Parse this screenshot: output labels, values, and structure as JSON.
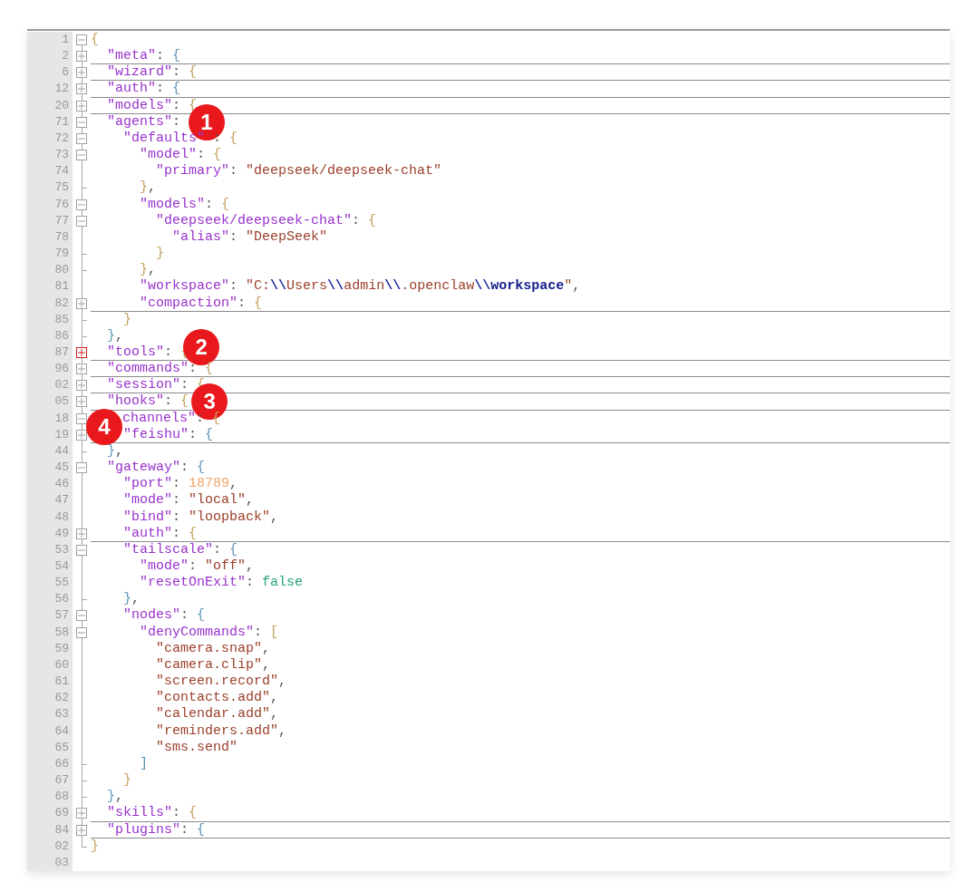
{
  "editor": {
    "lines": [
      {
        "number": "1",
        "kind": "start",
        "current": false,
        "tokens": [
          {
            "kind": "brace2",
            "text": "{"
          }
        ]
      },
      {
        "number": "2",
        "kind": "plus",
        "current": false,
        "tokens": [
          {
            "kind": "key",
            "text": "  \"meta\""
          },
          {
            "kind": "punct",
            "text": ": "
          },
          {
            "kind": "brace1",
            "text": "{"
          }
        ]
      },
      {
        "number": "6",
        "kind": "plus",
        "current": false,
        "tokens": [
          {
            "kind": "key",
            "text": "  \"wizard\""
          },
          {
            "kind": "punct",
            "text": ": "
          },
          {
            "kind": "brace2",
            "text": "{"
          }
        ]
      },
      {
        "number": "12",
        "kind": "plus",
        "current": false,
        "tokens": [
          {
            "kind": "key",
            "text": "  \"auth\""
          },
          {
            "kind": "punct",
            "text": ": "
          },
          {
            "kind": "brace1",
            "text": "{"
          }
        ]
      },
      {
        "number": "20",
        "kind": "plus",
        "current": false,
        "tokens": [
          {
            "kind": "key",
            "text": "  \"models\""
          },
          {
            "kind": "punct",
            "text": ": "
          },
          {
            "kind": "brace2",
            "text": "{"
          }
        ]
      },
      {
        "number": "71",
        "kind": "minus",
        "current": false,
        "tokens": [
          {
            "kind": "key",
            "text": "  \"agents\""
          },
          {
            "kind": "punct",
            "text": ":"
          },
          {
            "kind": "badge",
            "text": "1"
          }
        ]
      },
      {
        "number": "72",
        "kind": "minus",
        "current": false,
        "tokens": [
          {
            "kind": "key",
            "text": "    \"defaults\""
          },
          {
            "kind": "punct",
            "text": " : "
          },
          {
            "kind": "brace2",
            "text": "{"
          }
        ]
      },
      {
        "number": "73",
        "kind": "minus",
        "current": false,
        "tokens": [
          {
            "kind": "key",
            "text": "      \"model\""
          },
          {
            "kind": "punct",
            "text": ": "
          },
          {
            "kind": "brace2",
            "text": "{"
          }
        ]
      },
      {
        "number": "74",
        "kind": "bar",
        "current": false,
        "tokens": [
          {
            "kind": "key",
            "text": "        \"primary\""
          },
          {
            "kind": "punct",
            "text": ": "
          },
          {
            "kind": "str",
            "text": "\"deepseek/deepseek-chat\""
          }
        ]
      },
      {
        "number": "75",
        "kind": "end",
        "current": false,
        "tokens": [
          {
            "kind": "brace2",
            "text": "      }"
          },
          {
            "kind": "punct",
            "text": ","
          }
        ]
      },
      {
        "number": "76",
        "kind": "minus",
        "current": false,
        "tokens": [
          {
            "kind": "key",
            "text": "      \"models\""
          },
          {
            "kind": "punct",
            "text": ": "
          },
          {
            "kind": "brace2",
            "text": "{"
          }
        ]
      },
      {
        "number": "77",
        "kind": "minus",
        "current": false,
        "tokens": [
          {
            "kind": "key",
            "text": "        \"deepseek/deepseek-chat\""
          },
          {
            "kind": "punct",
            "text": ": "
          },
          {
            "kind": "brace2",
            "text": "{"
          }
        ]
      },
      {
        "number": "78",
        "kind": "bar",
        "current": false,
        "tokens": [
          {
            "kind": "key",
            "text": "          \"alias\""
          },
          {
            "kind": "punct",
            "text": ": "
          },
          {
            "kind": "str",
            "text": "\"DeepSeek\""
          }
        ]
      },
      {
        "number": "79",
        "kind": "end",
        "current": false,
        "tokens": [
          {
            "kind": "brace2",
            "text": "        }"
          }
        ]
      },
      {
        "number": "80",
        "kind": "end",
        "current": false,
        "tokens": [
          {
            "kind": "brace2",
            "text": "      }"
          },
          {
            "kind": "punct",
            "text": ","
          }
        ]
      },
      {
        "number": "81",
        "kind": "bar",
        "current": false,
        "tokens": [
          {
            "kind": "key",
            "text": "      \"workspace\""
          },
          {
            "kind": "punct",
            "text": ": "
          },
          {
            "kind": "str",
            "text": "\"C:"
          },
          {
            "kind": "esc",
            "text": "\\\\"
          },
          {
            "kind": "str",
            "text": "Users"
          },
          {
            "kind": "esc",
            "text": "\\\\"
          },
          {
            "kind": "str",
            "text": "admin"
          },
          {
            "kind": "esc",
            "text": "\\\\"
          },
          {
            "kind": "str",
            "text": ".openclaw"
          },
          {
            "kind": "esc",
            "text": "\\\\"
          },
          {
            "kind": "kw",
            "text": "workspace"
          },
          {
            "kind": "str",
            "text": "\""
          },
          {
            "kind": "punct",
            "text": ","
          }
        ]
      },
      {
        "number": "82",
        "kind": "plus",
        "current": false,
        "tokens": [
          {
            "kind": "key",
            "text": "      \"compaction\""
          },
          {
            "kind": "punct",
            "text": ": "
          },
          {
            "kind": "brace2",
            "text": "{"
          }
        ]
      },
      {
        "number": "85",
        "kind": "end",
        "current": false,
        "tokens": [
          {
            "kind": "brace2",
            "text": "    }"
          }
        ]
      },
      {
        "number": "86",
        "kind": "end",
        "current": false,
        "tokens": [
          {
            "kind": "brace1",
            "text": "  }"
          },
          {
            "kind": "punct",
            "text": ","
          }
        ]
      },
      {
        "number": "87",
        "kind": "plus",
        "current": true,
        "tokens": [
          {
            "kind": "key",
            "text": "  \"tools\""
          },
          {
            "kind": "punct",
            "text": ": "
          },
          {
            "kind": "brace2",
            "text": "{"
          },
          {
            "kind": "badge",
            "text": "2"
          }
        ]
      },
      {
        "number": "96",
        "kind": "plus",
        "current": false,
        "tokens": [
          {
            "kind": "key",
            "text": "  \"commands\""
          },
          {
            "kind": "punct",
            "text": ": "
          },
          {
            "kind": "brace2",
            "text": "{"
          }
        ]
      },
      {
        "number": "02",
        "kind": "plus",
        "current": false,
        "tokens": [
          {
            "kind": "key",
            "text": "  \"session\""
          },
          {
            "kind": "punct",
            "text": ": "
          },
          {
            "kind": "brace2",
            "text": "{"
          }
        ]
      },
      {
        "number": "05",
        "kind": "plus",
        "current": false,
        "tokens": [
          {
            "kind": "key",
            "text": "  \"hooks\""
          },
          {
            "kind": "punct",
            "text": ": "
          },
          {
            "kind": "brace2",
            "text": "{"
          },
          {
            "kind": "badge",
            "text": "3"
          }
        ]
      },
      {
        "number": "18",
        "kind": "minus",
        "current": false,
        "tokens": [
          {
            "kind": "badge",
            "text": "4"
          },
          {
            "kind": "key",
            "text": "channels\""
          },
          {
            "kind": "punct",
            "text": ": "
          },
          {
            "kind": "brace2",
            "text": "{"
          }
        ]
      },
      {
        "number": "19",
        "kind": "plus",
        "current": false,
        "tokens": [
          {
            "kind": "key",
            "text": "    \"feishu\""
          },
          {
            "kind": "punct",
            "text": ": "
          },
          {
            "kind": "brace1",
            "text": "{"
          }
        ]
      },
      {
        "number": "44",
        "kind": "end",
        "current": false,
        "tokens": [
          {
            "kind": "brace1",
            "text": "  }"
          },
          {
            "kind": "punct",
            "text": ","
          }
        ]
      },
      {
        "number": "45",
        "kind": "minus",
        "current": false,
        "tokens": [
          {
            "kind": "key",
            "text": "  \"gateway\""
          },
          {
            "kind": "punct",
            "text": ": "
          },
          {
            "kind": "brace1",
            "text": "{"
          }
        ]
      },
      {
        "number": "46",
        "kind": "bar",
        "current": false,
        "tokens": [
          {
            "kind": "key",
            "text": "    \"port\""
          },
          {
            "kind": "punct",
            "text": ": "
          },
          {
            "kind": "num",
            "text": "18789"
          },
          {
            "kind": "punct",
            "text": ","
          }
        ]
      },
      {
        "number": "47",
        "kind": "bar",
        "current": false,
        "tokens": [
          {
            "kind": "key",
            "text": "    \"mode\""
          },
          {
            "kind": "punct",
            "text": ": "
          },
          {
            "kind": "str",
            "text": "\"local\""
          },
          {
            "kind": "punct",
            "text": ","
          }
        ]
      },
      {
        "number": "48",
        "kind": "bar",
        "current": false,
        "tokens": [
          {
            "kind": "key",
            "text": "    \"bind\""
          },
          {
            "kind": "punct",
            "text": ": "
          },
          {
            "kind": "str",
            "text": "\"loopback\""
          },
          {
            "kind": "punct",
            "text": ","
          }
        ]
      },
      {
        "number": "49",
        "kind": "plus",
        "current": false,
        "tokens": [
          {
            "kind": "key",
            "text": "    \"auth\""
          },
          {
            "kind": "punct",
            "text": ": "
          },
          {
            "kind": "brace2",
            "text": "{"
          }
        ]
      },
      {
        "number": "53",
        "kind": "minus",
        "current": false,
        "tokens": [
          {
            "kind": "key",
            "text": "    \"tailscale\""
          },
          {
            "kind": "punct",
            "text": ": "
          },
          {
            "kind": "brace1",
            "text": "{"
          }
        ]
      },
      {
        "number": "54",
        "kind": "bar",
        "current": false,
        "tokens": [
          {
            "kind": "key",
            "text": "      \"mode\""
          },
          {
            "kind": "punct",
            "text": ": "
          },
          {
            "kind": "str",
            "text": "\"off\""
          },
          {
            "kind": "punct",
            "text": ","
          }
        ]
      },
      {
        "number": "55",
        "kind": "bar",
        "current": false,
        "tokens": [
          {
            "kind": "key",
            "text": "      \"resetOnExit\""
          },
          {
            "kind": "punct",
            "text": ": "
          },
          {
            "kind": "bool",
            "text": "false"
          }
        ]
      },
      {
        "number": "56",
        "kind": "end",
        "current": false,
        "tokens": [
          {
            "kind": "brace1",
            "text": "    }"
          },
          {
            "kind": "punct",
            "text": ","
          }
        ]
      },
      {
        "number": "57",
        "kind": "minus",
        "current": false,
        "tokens": [
          {
            "kind": "key",
            "text": "    \"nodes\""
          },
          {
            "kind": "punct",
            "text": ": "
          },
          {
            "kind": "brace1",
            "text": "{"
          }
        ]
      },
      {
        "number": "58",
        "kind": "minus",
        "current": false,
        "tokens": [
          {
            "kind": "key",
            "text": "      \"denyCommands\""
          },
          {
            "kind": "punct",
            "text": ": "
          },
          {
            "kind": "brace2",
            "text": "["
          }
        ]
      },
      {
        "number": "59",
        "kind": "bar",
        "current": false,
        "tokens": [
          {
            "kind": "str",
            "text": "        \"camera.snap\""
          },
          {
            "kind": "punct",
            "text": ","
          }
        ]
      },
      {
        "number": "60",
        "kind": "bar",
        "current": false,
        "tokens": [
          {
            "kind": "str",
            "text": "        \"camera.clip\""
          },
          {
            "kind": "punct",
            "text": ","
          }
        ]
      },
      {
        "number": "61",
        "kind": "bar",
        "current": false,
        "tokens": [
          {
            "kind": "str",
            "text": "        \"screen.record\""
          },
          {
            "kind": "punct",
            "text": ","
          }
        ]
      },
      {
        "number": "62",
        "kind": "bar",
        "current": false,
        "tokens": [
          {
            "kind": "str",
            "text": "        \"contacts.add\""
          },
          {
            "kind": "punct",
            "text": ","
          }
        ]
      },
      {
        "number": "63",
        "kind": "bar",
        "current": false,
        "tokens": [
          {
            "kind": "str",
            "text": "        \"calendar.add\""
          },
          {
            "kind": "punct",
            "text": ","
          }
        ]
      },
      {
        "number": "64",
        "kind": "bar",
        "current": false,
        "tokens": [
          {
            "kind": "str",
            "text": "        \"reminders.add\""
          },
          {
            "kind": "punct",
            "text": ","
          }
        ]
      },
      {
        "number": "65",
        "kind": "bar",
        "current": false,
        "tokens": [
          {
            "kind": "str",
            "text": "        \"sms.send\""
          }
        ]
      },
      {
        "number": "66",
        "kind": "end",
        "current": false,
        "tokens": [
          {
            "kind": "brace1",
            "text": "      ]"
          }
        ]
      },
      {
        "number": "67",
        "kind": "end",
        "current": false,
        "tokens": [
          {
            "kind": "brace2",
            "text": "    }"
          }
        ]
      },
      {
        "number": "68",
        "kind": "end",
        "current": false,
        "tokens": [
          {
            "kind": "brace1",
            "text": "  }"
          },
          {
            "kind": "punct",
            "text": ","
          }
        ]
      },
      {
        "number": "69",
        "kind": "plus",
        "current": false,
        "tokens": [
          {
            "kind": "key",
            "text": "  \"skills\""
          },
          {
            "kind": "punct",
            "text": ": "
          },
          {
            "kind": "brace2",
            "text": "{"
          }
        ]
      },
      {
        "number": "84",
        "kind": "plus",
        "current": false,
        "tokens": [
          {
            "kind": "key",
            "text": "  \"plugins\""
          },
          {
            "kind": "punct",
            "text": ": "
          },
          {
            "kind": "brace1",
            "text": "{"
          }
        ]
      },
      {
        "number": "02",
        "kind": "last",
        "current": false,
        "tokens": [
          {
            "kind": "brace2",
            "text": "}"
          }
        ]
      },
      {
        "number": "03",
        "kind": "none",
        "current": false
      }
    ]
  }
}
